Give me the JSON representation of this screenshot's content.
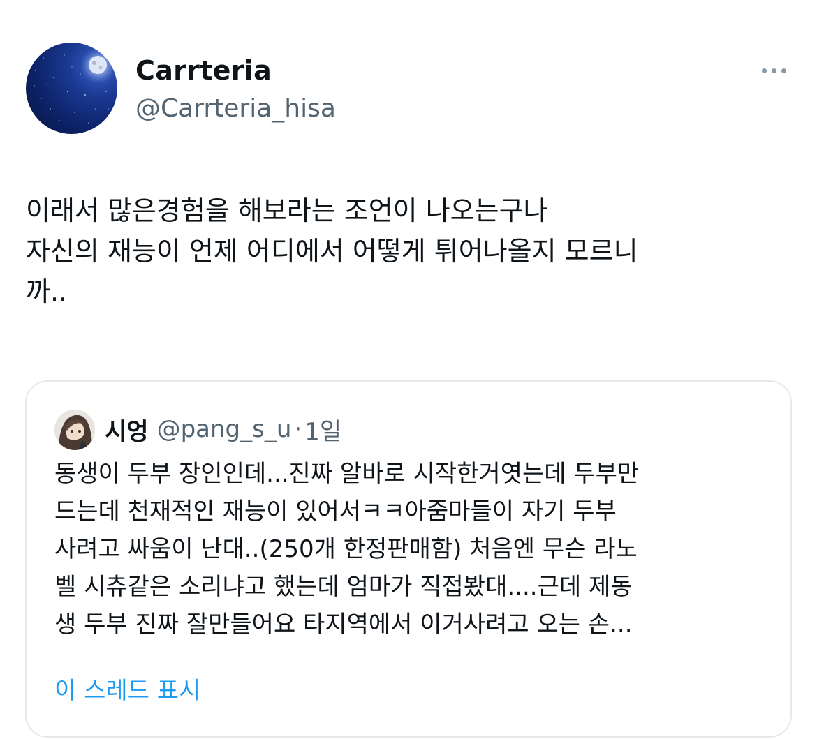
{
  "tweet": {
    "author": {
      "display_name": "Carrteria",
      "handle": "@Carrteria_hisa",
      "avatar_icon": "night-sky-moon-avatar"
    },
    "more_icon": "more-horizontal-icon",
    "text_lines": [
      "이래서 많은경험을 해보라는 조언이 나오는구나",
      "자신의 재능이 언제 어디에서 어떻게 튀어나올지 모르니",
      "까.."
    ]
  },
  "quote": {
    "author": {
      "display_name": "시엉",
      "handle": "@pang_s_u",
      "separator": "·",
      "time": "1일",
      "avatar_icon": "anime-character-avatar"
    },
    "text_lines": [
      "동생이 두부 장인인데...진짜 알바로 시작한거엿는데 두부만",
      "드는데 천재적인 재능이 있어서ㅋㅋ아줌마들이 자기 두부",
      "사려고 싸움이 난대..(250개 한정판매함) 처음엔 무슨 라노",
      "벨 시츄같은 소리냐고 했는데 엄마가 직접봤대....근데 제동",
      "생 두부 진짜 잘만들어요 타지역에서 이거사려고 오는 손..."
    ],
    "show_thread_label": "이 스레드 표시"
  },
  "colors": {
    "text_primary": "#0f1419",
    "text_secondary": "#536471",
    "link": "#1d9bf0",
    "border": "#e6e9eb"
  }
}
